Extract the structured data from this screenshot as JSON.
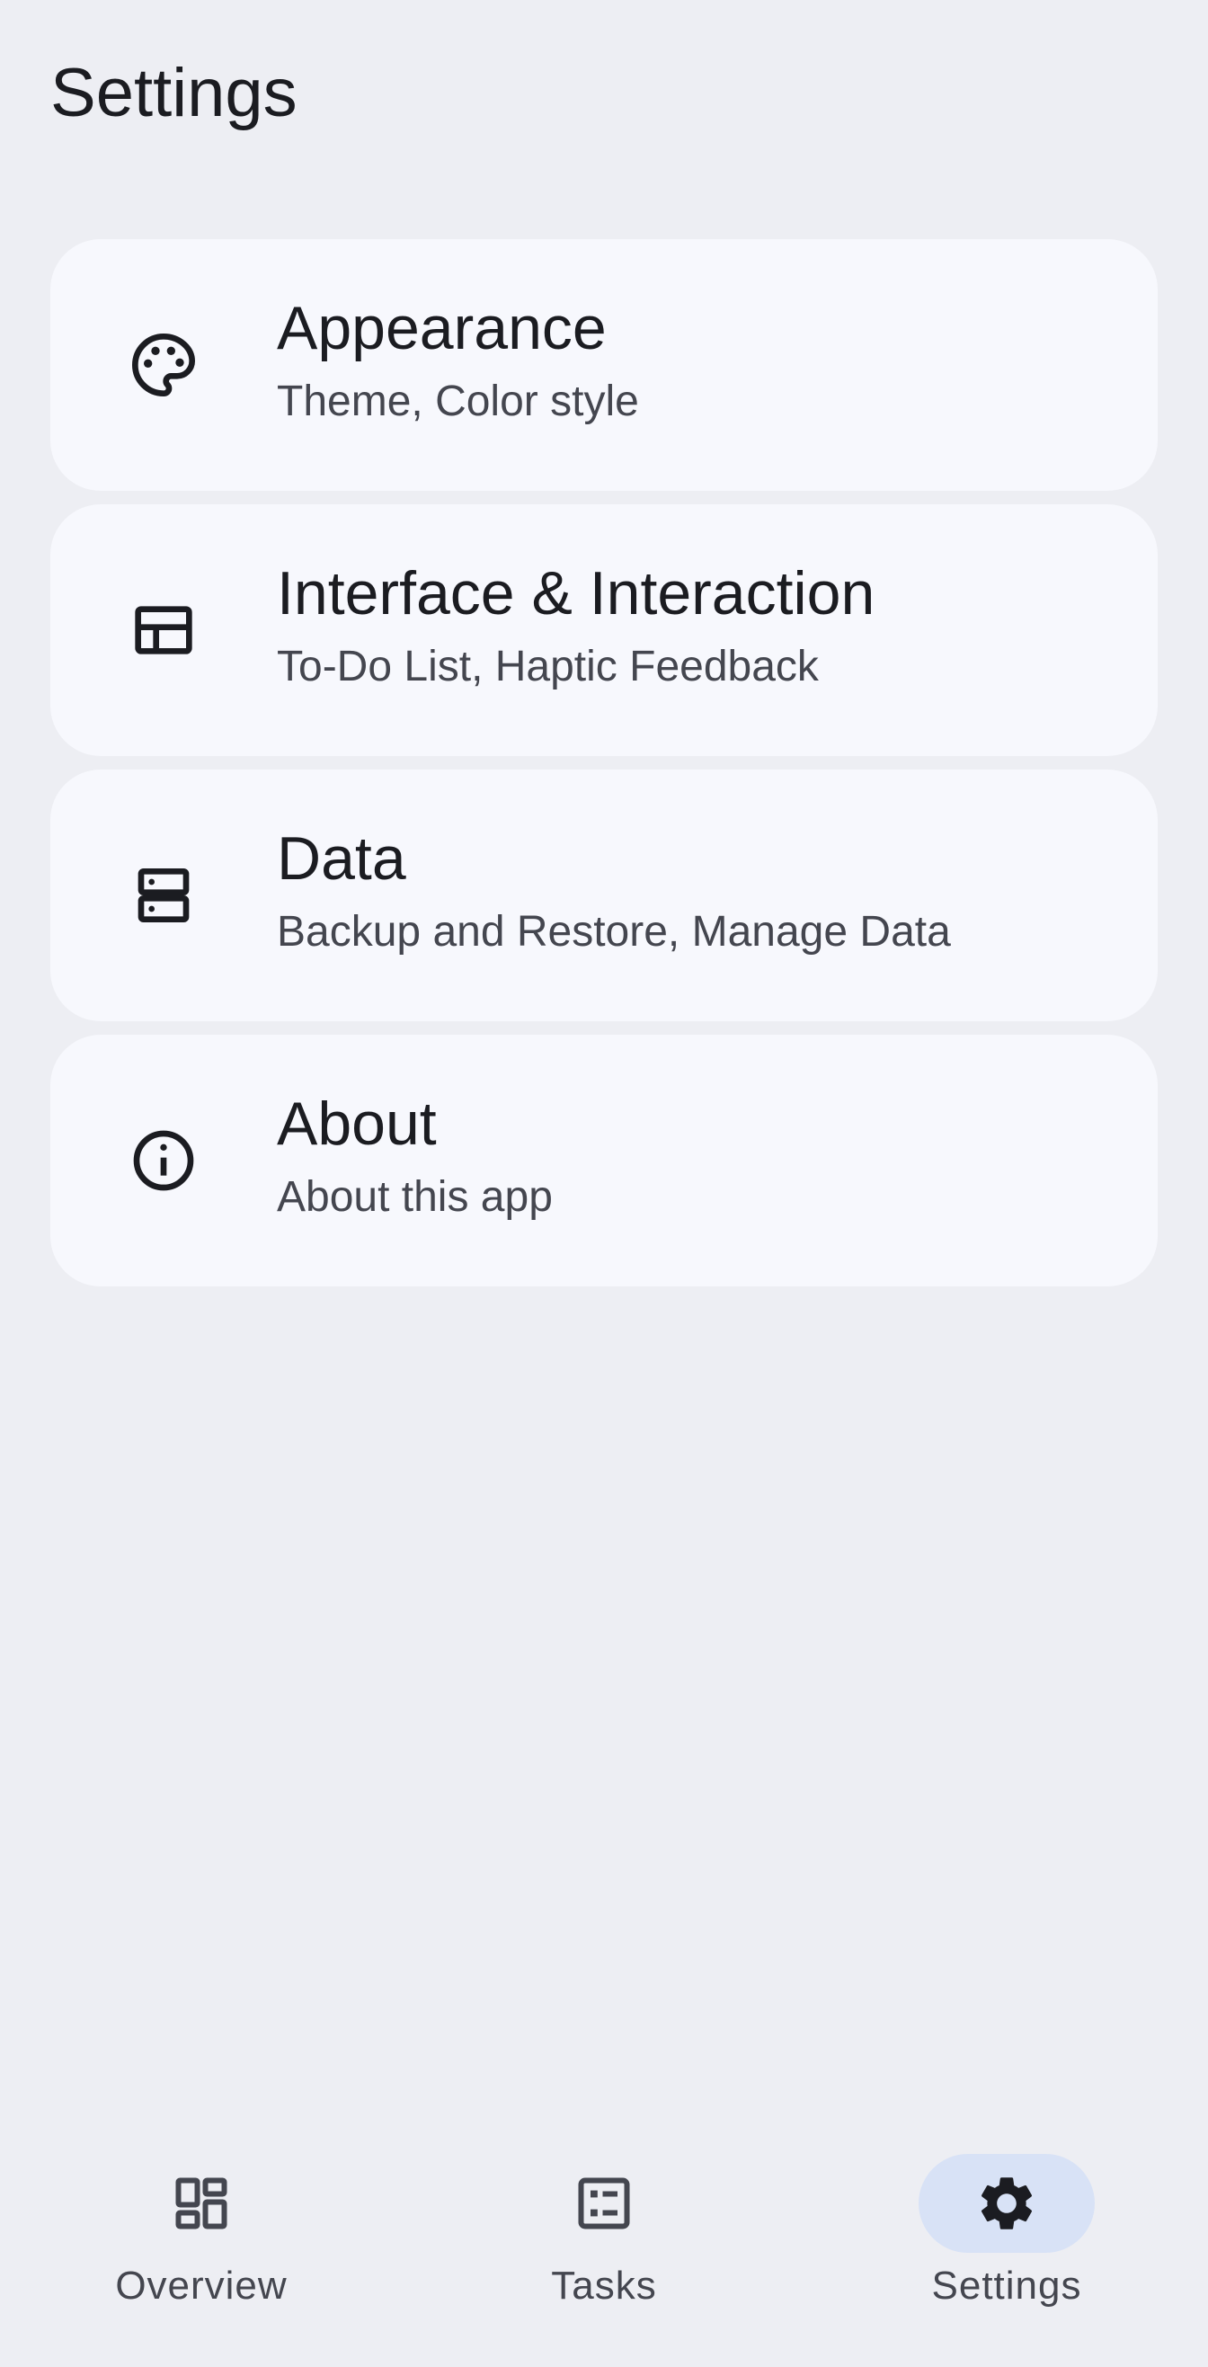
{
  "header": {
    "title": "Settings"
  },
  "settings_items": [
    {
      "title": "Appearance",
      "subtitle": "Theme, Color style",
      "icon": "palette-icon"
    },
    {
      "title": "Interface & Interaction",
      "subtitle": "To-Do List, Haptic Feedback",
      "icon": "layout-icon"
    },
    {
      "title": "Data",
      "subtitle": "Backup and Restore, Manage Data",
      "icon": "storage-icon"
    },
    {
      "title": "About",
      "subtitle": "About this app",
      "icon": "info-icon"
    }
  ],
  "bottom_nav": {
    "items": [
      {
        "label": "Overview",
        "icon": "dashboard-icon",
        "active": false
      },
      {
        "label": "Tasks",
        "icon": "task-list-icon",
        "active": false
      },
      {
        "label": "Settings",
        "icon": "gear-icon",
        "active": true
      }
    ]
  },
  "colors": {
    "background": "#edeef3",
    "card": "#f7f8fd",
    "active_pill": "#d8e2f6",
    "text_primary": "#1b1c21",
    "text_secondary": "#44464f"
  }
}
